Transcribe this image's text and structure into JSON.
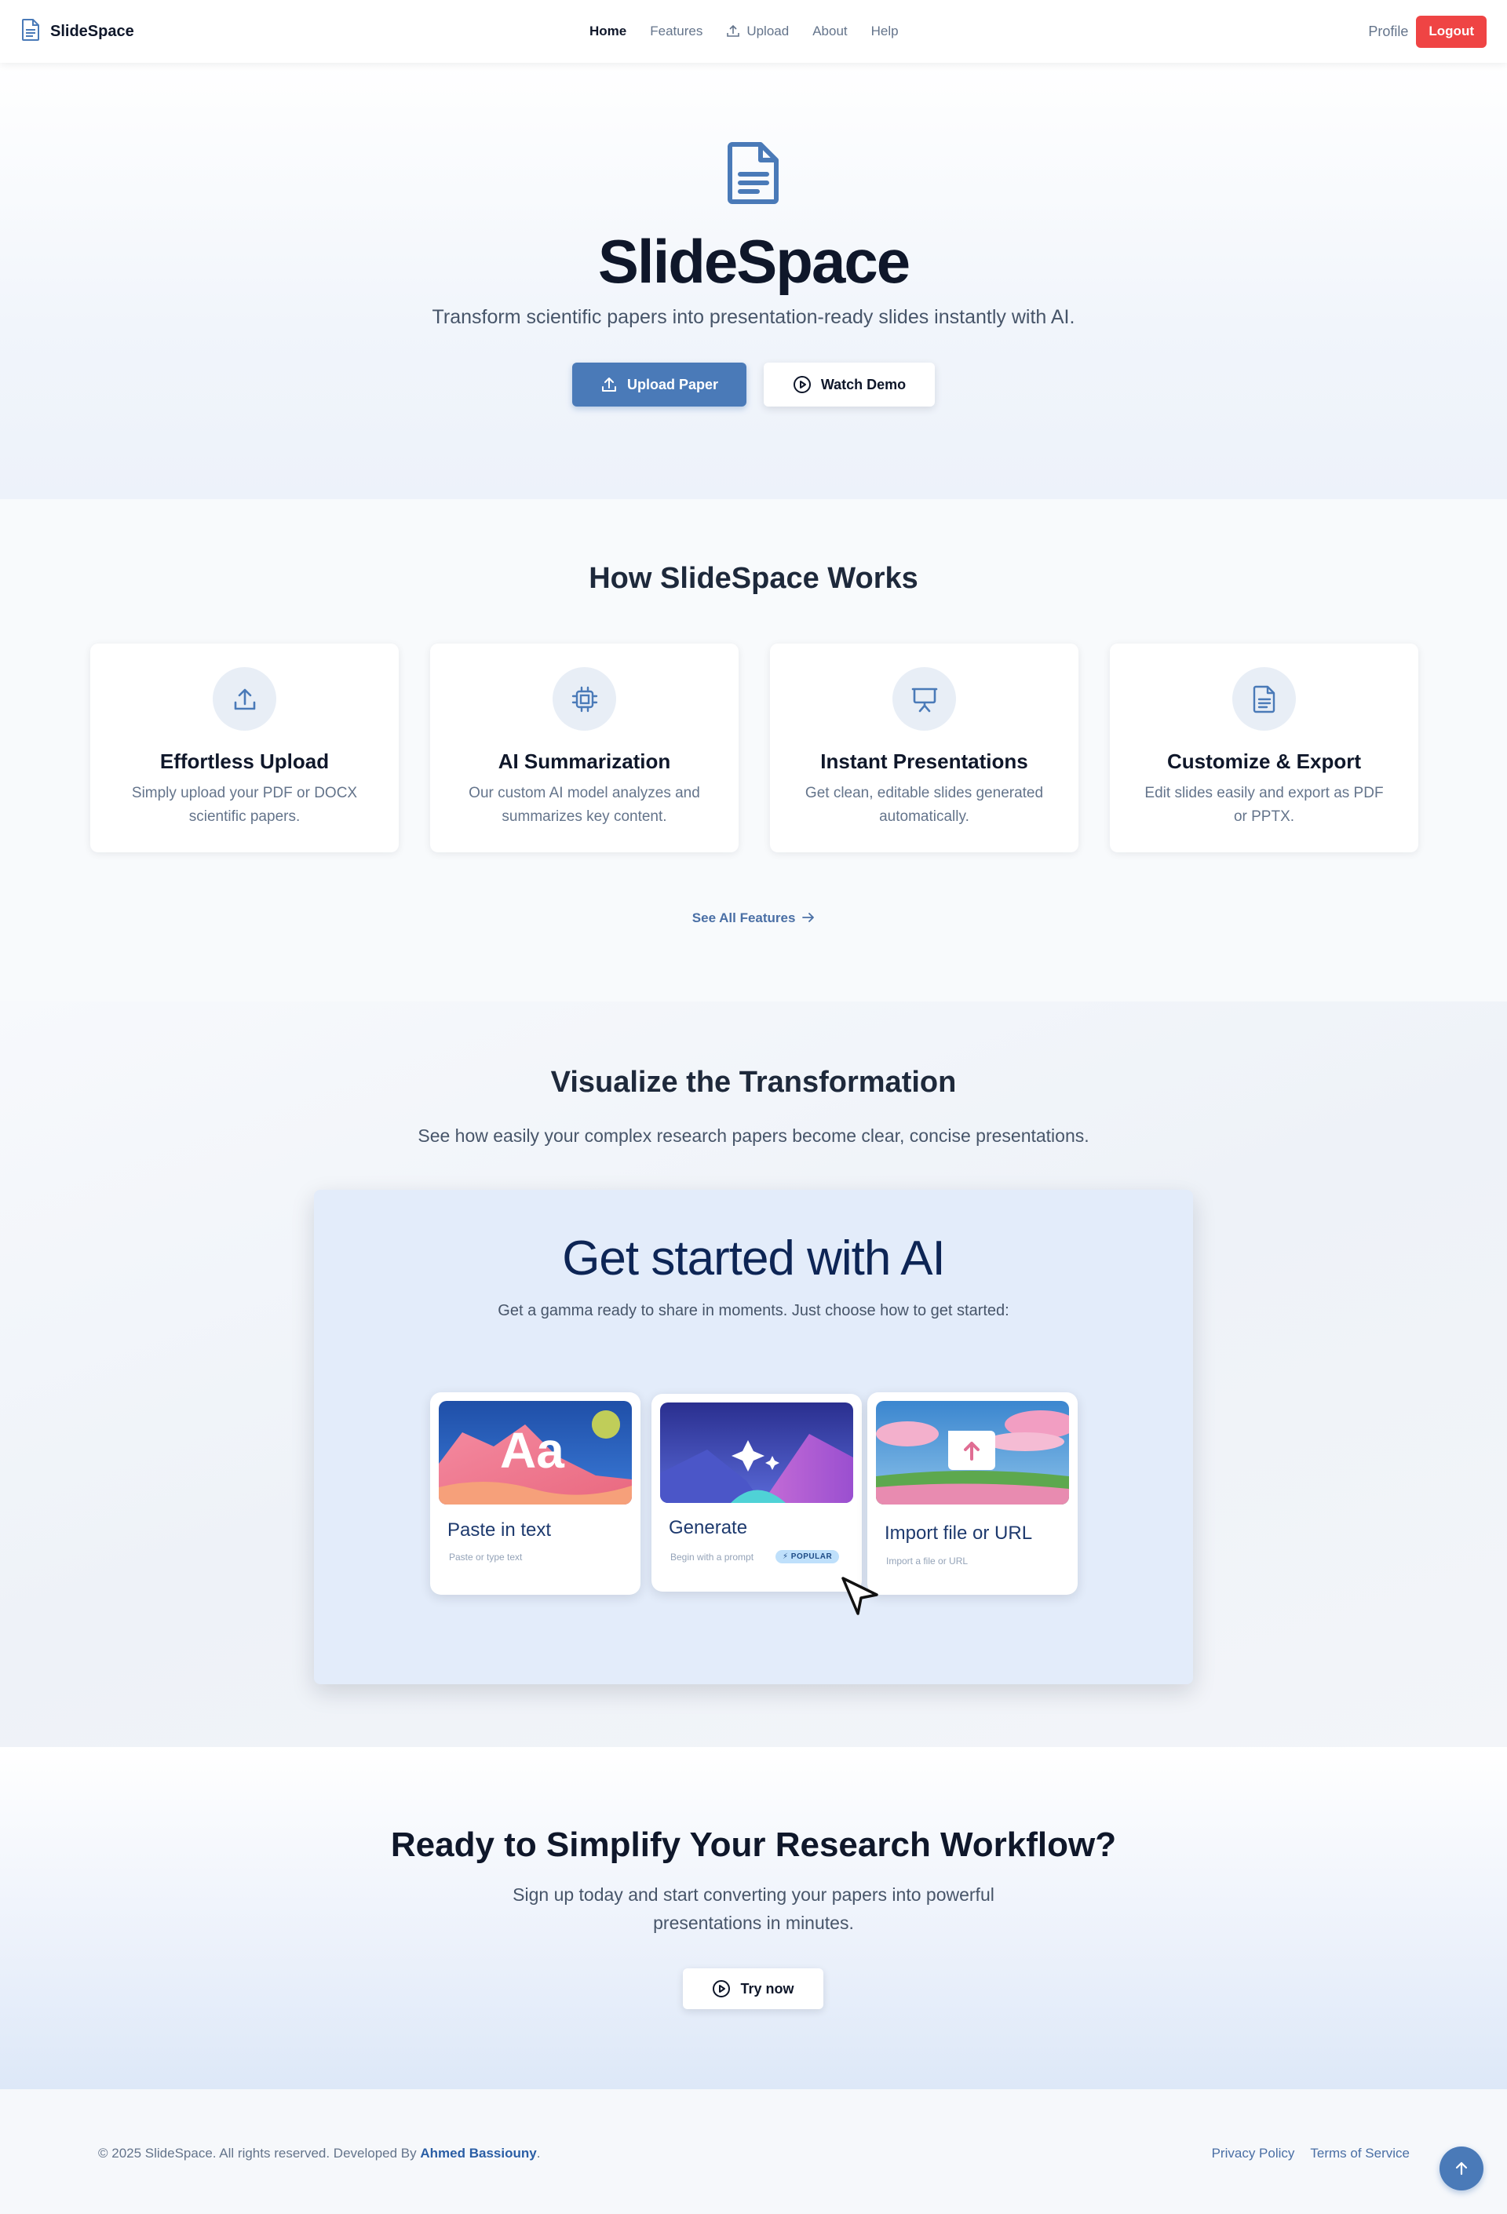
{
  "colors": {
    "primary": "#4a7ab8",
    "logout": "#ef4444",
    "heading": "#0f172a",
    "muted": "#64748b"
  },
  "nav": {
    "brand": "SlideSpace",
    "links": [
      "Home",
      "Features",
      "Upload",
      "About",
      "Help"
    ],
    "profile": "Profile",
    "logout": "Logout"
  },
  "hero": {
    "title": "SlideSpace",
    "subtitle": "Transform scientific papers into presentation-ready slides instantly with AI.",
    "upload_button": "Upload Paper",
    "demo_button": "Watch Demo"
  },
  "how": {
    "title": "How SlideSpace Works",
    "cards": [
      {
        "icon": "upload-icon",
        "title": "Effortless Upload",
        "description": "Simply upload your PDF or DOCX scientific papers."
      },
      {
        "icon": "cpu-chip-icon",
        "title": "AI Summarization",
        "description": "Our custom AI model analyzes and summarizes key content."
      },
      {
        "icon": "presentation-icon",
        "title": "Instant Presentations",
        "description": "Get clean, editable slides generated automatically."
      },
      {
        "icon": "document-icon",
        "title": "Customize & Export",
        "description": "Edit slides easily and export as PDF or PPTX."
      }
    ],
    "see_all": "See All Features"
  },
  "visualize": {
    "title": "Visualize the Transformation",
    "subtitle": "See how easily your complex research papers become clear, concise presentations.",
    "demo": {
      "title": "Get started with AI",
      "subtitle": "Get a gamma ready to share in moments. Just choose how to get started:",
      "options": [
        {
          "title": "Paste in text",
          "sub": "Paste or type text",
          "image_text": "Aa"
        },
        {
          "title": "Generate",
          "sub": "Begin with a prompt",
          "badge": "⚡ POPULAR"
        },
        {
          "title": "Import file or URL",
          "sub": "Import a file or URL"
        }
      ]
    }
  },
  "cta": {
    "title": "Ready to Simplify Your Research Workflow?",
    "subtitle": "Sign up today and start converting your papers into powerful presentations in minutes.",
    "button": "Try now"
  },
  "footer": {
    "copyright": "© 2025 SlideSpace. All rights reserved. Developed By",
    "author": "Ahmed Bassiouny",
    "period": ".",
    "links": [
      "Privacy Policy",
      "Terms of Service"
    ]
  }
}
